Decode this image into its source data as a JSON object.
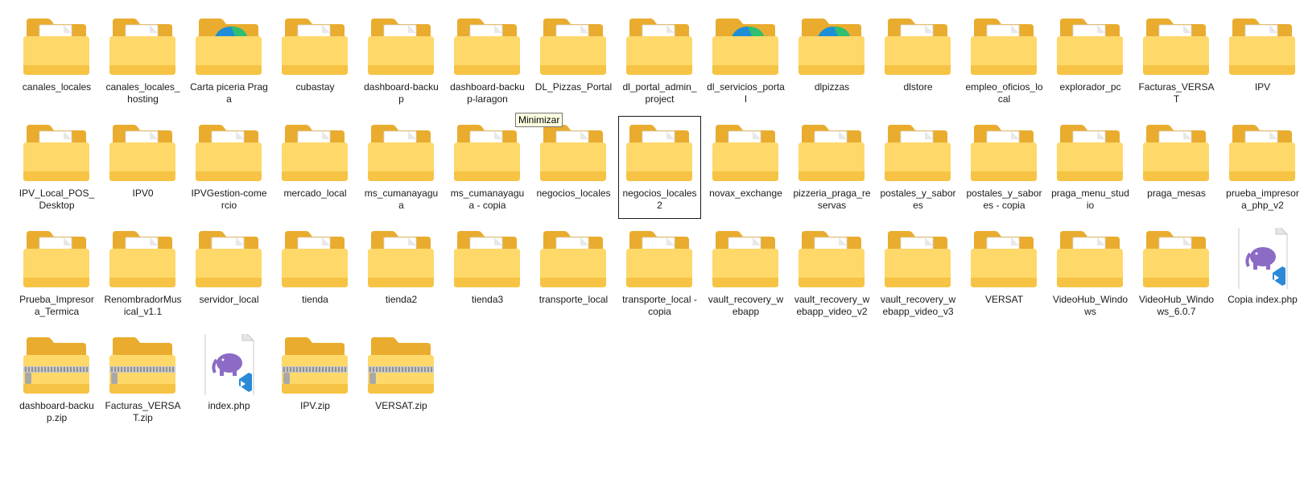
{
  "tooltip": "Minimizar",
  "colors": {
    "folder_back": "#e9ac2e",
    "folder_front": "#ffd86a",
    "selection_border": "#1a1a1a",
    "php_elephant": "#8b6bc6",
    "vscode_badge": "#2a8ad8"
  },
  "items": [
    {
      "name": "canales_locales",
      "kind": "folder",
      "preview": "doc"
    },
    {
      "name": "canales_locales_hosting",
      "kind": "folder",
      "preview": "db"
    },
    {
      "name": "Carta piceria Praga",
      "kind": "folder",
      "preview": "edge"
    },
    {
      "name": "cubastay",
      "kind": "folder",
      "preview": "doc"
    },
    {
      "name": "dashboard-backup",
      "kind": "folder",
      "preview": "php"
    },
    {
      "name": "dashboard-backup-laragon",
      "kind": "folder",
      "preview": "php"
    },
    {
      "name": "DL_Pizzas_Portal",
      "kind": "folder",
      "preview": "php"
    },
    {
      "name": "dl_portal_admin_project",
      "kind": "folder",
      "preview": "doc"
    },
    {
      "name": "dl_servicios_portal",
      "kind": "folder",
      "preview": "edge"
    },
    {
      "name": "dlpizzas",
      "kind": "folder",
      "preview": "edge"
    },
    {
      "name": "dlstore",
      "kind": "folder",
      "preview": "doc"
    },
    {
      "name": "empleo_oficios_local",
      "kind": "folder",
      "preview": "php"
    },
    {
      "name": "explorador_pc",
      "kind": "folder",
      "preview": "php"
    },
    {
      "name": "Facturas_VERSAT",
      "kind": "folder",
      "preview": "php"
    },
    {
      "name": "IPV",
      "kind": "folder",
      "preview": "php"
    },
    {
      "name": "IPV_Local_POS_Desktop",
      "kind": "folder",
      "preview": "gear"
    },
    {
      "name": "IPV0",
      "kind": "folder",
      "preview": "php"
    },
    {
      "name": "IPVGestion-comercio",
      "kind": "folder",
      "preview": "doc"
    },
    {
      "name": "mercado_local",
      "kind": "folder",
      "preview": "php"
    },
    {
      "name": "ms_cumanayagua",
      "kind": "folder",
      "preview": "php"
    },
    {
      "name": "ms_cumanayagua - copia",
      "kind": "folder",
      "preview": "lines"
    },
    {
      "name": "negocios_locales",
      "kind": "folder",
      "preview": "php"
    },
    {
      "name": "negocios_locales2",
      "kind": "folder",
      "preview": "doc",
      "selected": true
    },
    {
      "name": "novax_exchange",
      "kind": "folder",
      "preview": "gear"
    },
    {
      "name": "pizzeria_praga_reservas",
      "kind": "folder",
      "preview": "doc"
    },
    {
      "name": "postales_y_sabores",
      "kind": "folder",
      "preview": "doc"
    },
    {
      "name": "postales_y_sabores - copia",
      "kind": "folder",
      "preview": "doc"
    },
    {
      "name": "praga_menu_studio",
      "kind": "folder",
      "preview": "php"
    },
    {
      "name": "praga_mesas",
      "kind": "folder",
      "preview": "php"
    },
    {
      "name": "prueba_impresora_php_v2",
      "kind": "folder",
      "preview": "php"
    },
    {
      "name": "Prueba_Impresora_Termica",
      "kind": "folder",
      "preview": "blue"
    },
    {
      "name": "RenombradorMusical_v1.1",
      "kind": "folder",
      "preview": "doc"
    },
    {
      "name": "servidor_local",
      "kind": "folder",
      "preview": "doc"
    },
    {
      "name": "tienda",
      "kind": "folder",
      "preview": "php"
    },
    {
      "name": "tienda2",
      "kind": "folder",
      "preview": "php"
    },
    {
      "name": "tienda3",
      "kind": "folder",
      "preview": "php"
    },
    {
      "name": "transporte_local",
      "kind": "folder",
      "preview": "php"
    },
    {
      "name": "transporte_local - copia",
      "kind": "folder",
      "preview": "hash"
    },
    {
      "name": "vault_recovery_webapp",
      "kind": "folder",
      "preview": "doc"
    },
    {
      "name": "vault_recovery_webapp_video_v2",
      "kind": "folder",
      "preview": "doc"
    },
    {
      "name": "vault_recovery_webapp_video_v3",
      "kind": "folder",
      "preview": "doc"
    },
    {
      "name": "VERSAT",
      "kind": "folder",
      "preview": "php"
    },
    {
      "name": "VideoHub_Windows",
      "kind": "folder",
      "preview": "doc"
    },
    {
      "name": "VideoHub_Windows_6.0.7",
      "kind": "folder",
      "preview": "doc"
    },
    {
      "name": "Copia index.php",
      "kind": "php-file"
    },
    {
      "name": "dashboard-backup.zip",
      "kind": "zip"
    },
    {
      "name": "Facturas_VERSAT.zip",
      "kind": "zip"
    },
    {
      "name": "index.php",
      "kind": "php-file"
    },
    {
      "name": "IPV.zip",
      "kind": "zip"
    },
    {
      "name": "VERSAT.zip",
      "kind": "zip"
    }
  ]
}
